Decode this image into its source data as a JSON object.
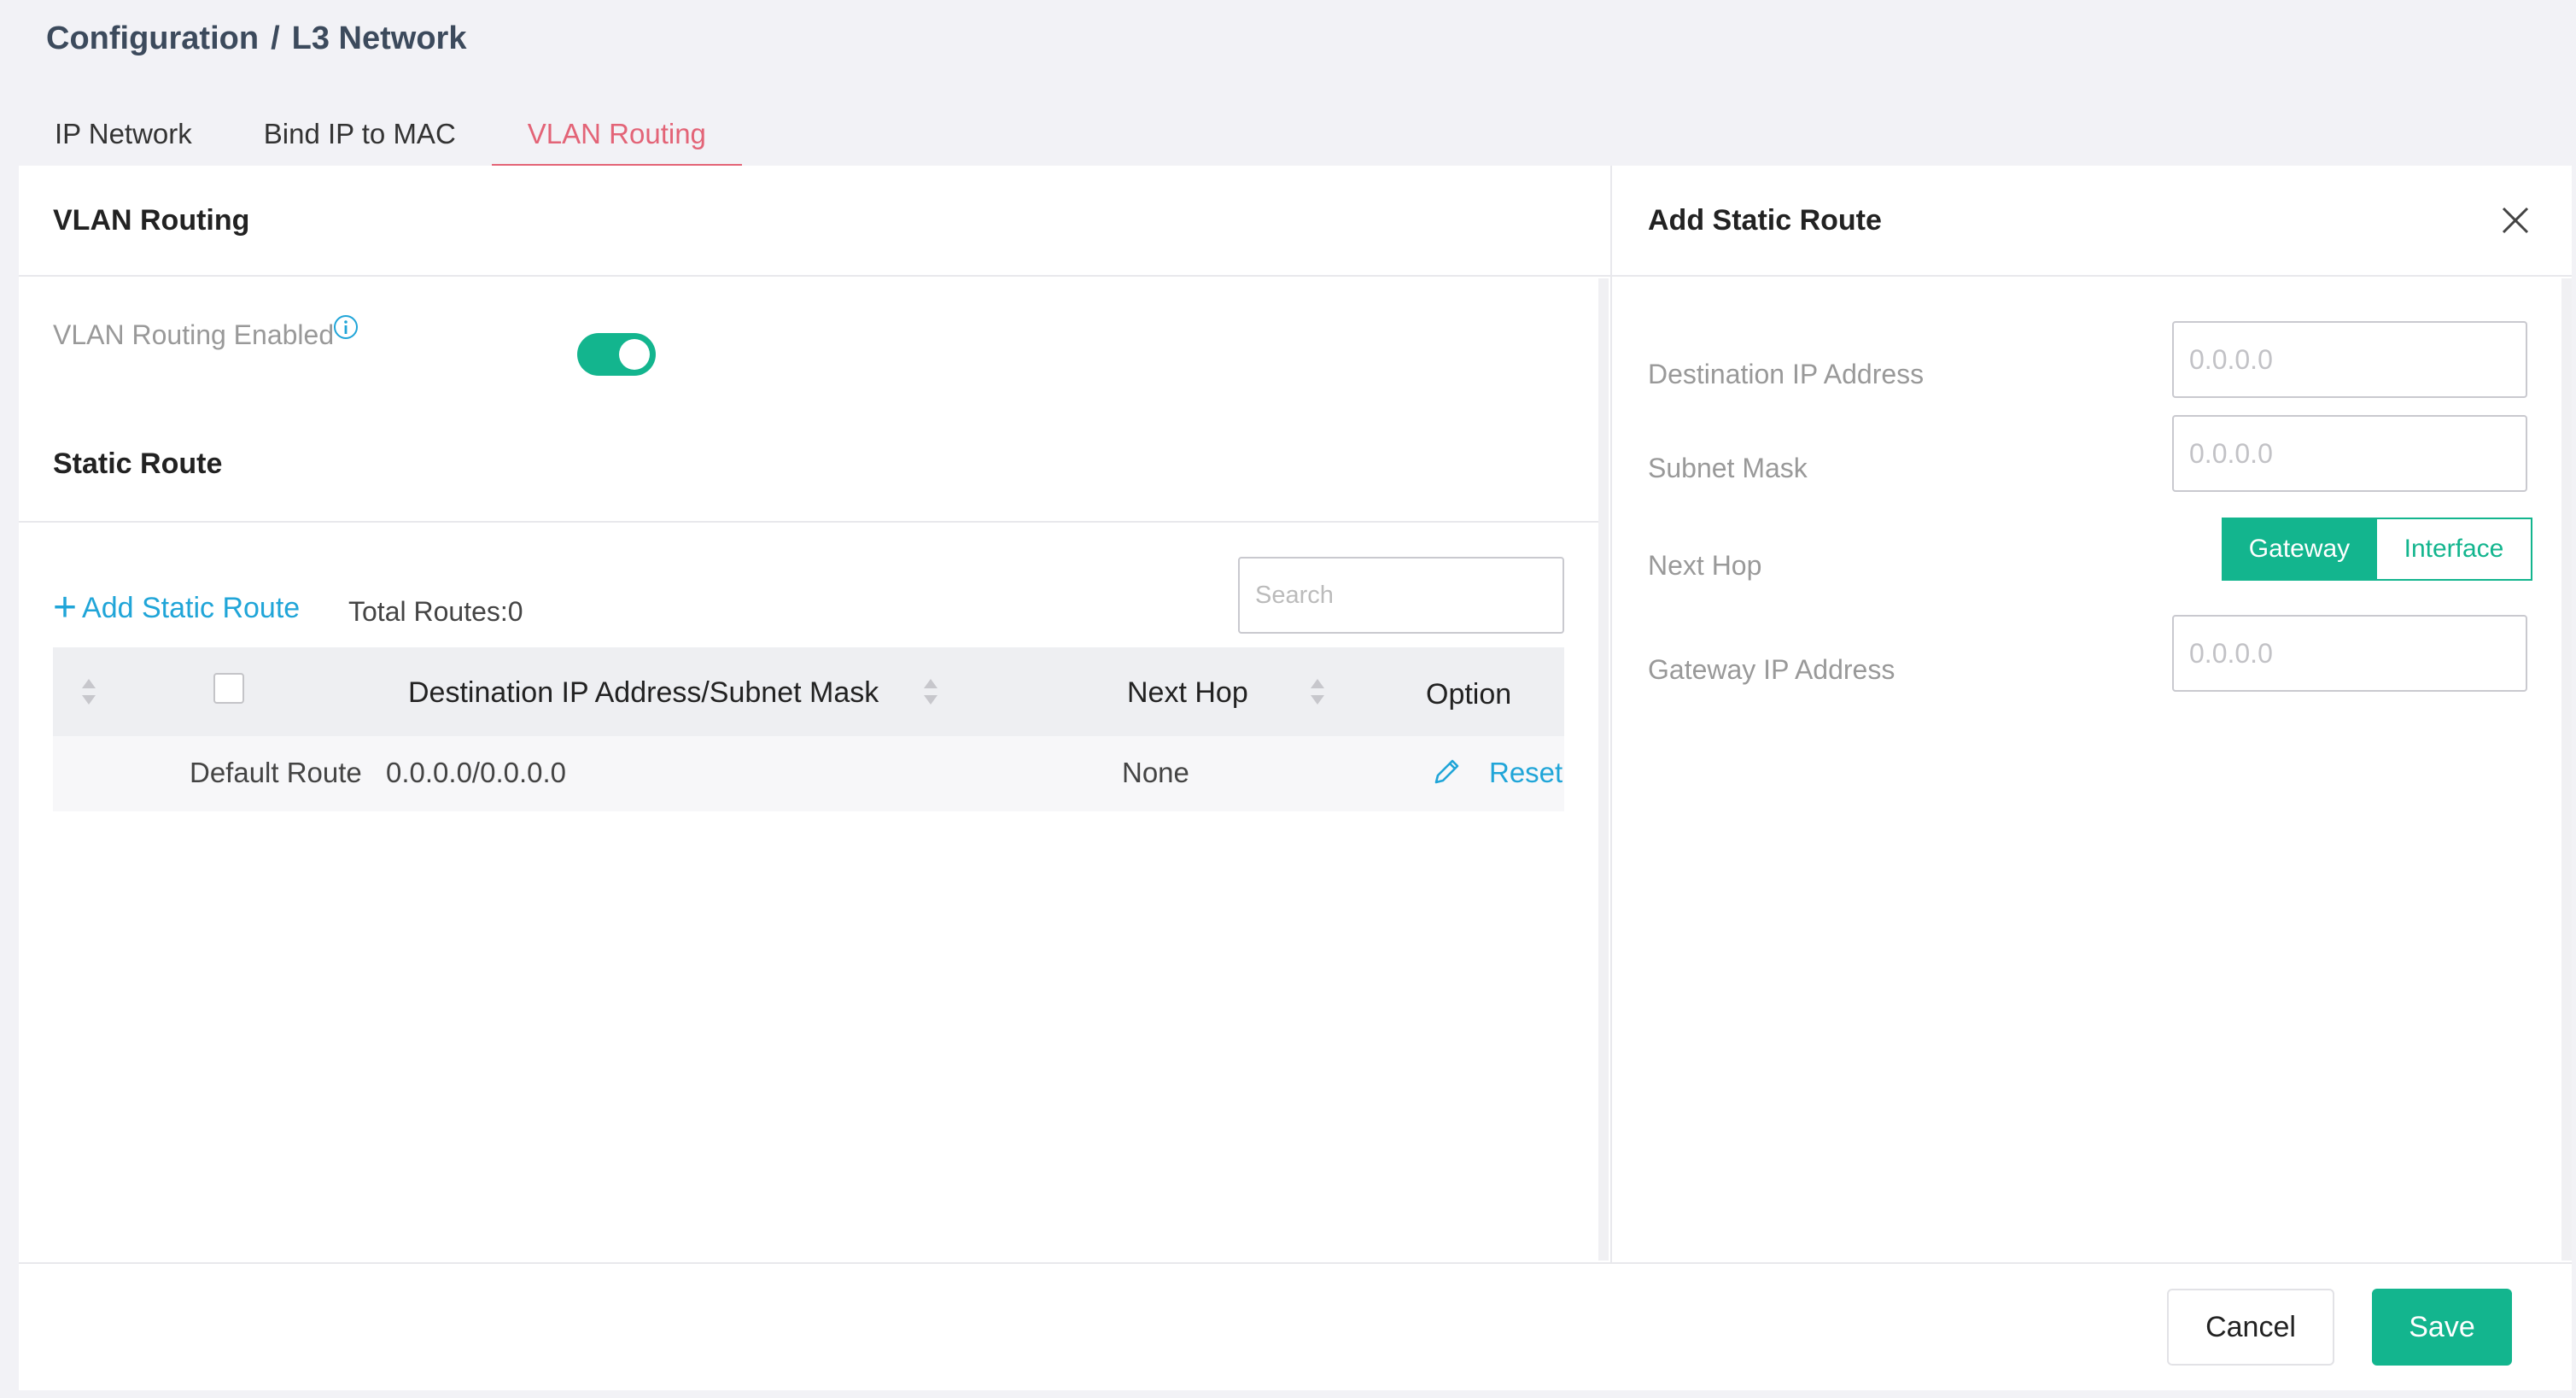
{
  "breadcrumb": {
    "root": "Configuration",
    "separator": "/",
    "current": "L3 Network"
  },
  "tabs": [
    {
      "label": "IP Network"
    },
    {
      "label": "Bind IP to MAC"
    },
    {
      "label": "VLAN Routing"
    }
  ],
  "left_panel": {
    "title": "VLAN Routing",
    "routing_enabled_label": "VLAN Routing Enabled",
    "routing_enabled": true,
    "section_title": "Static Route",
    "add_route_label": "Add Static Route",
    "total_routes_label": "Total Routes:0",
    "search_placeholder": "Search",
    "table": {
      "columns": [
        "Destination IP Address/Subnet Mask",
        "Next Hop",
        "Option"
      ],
      "rows": [
        {
          "name": "Default Route",
          "destination": "0.0.0.0/0.0.0.0",
          "next_hop": "None",
          "action": "Reset"
        }
      ]
    }
  },
  "right_panel": {
    "title": "Add Static Route",
    "fields": {
      "destination_label": "Destination IP Address",
      "destination_placeholder": "0.0.0.0",
      "subnet_label": "Subnet Mask",
      "subnet_placeholder": "0.0.0.0",
      "next_hop_label": "Next Hop",
      "next_hop_options": [
        "Gateway",
        "Interface"
      ],
      "next_hop_selected": "Gateway",
      "gateway_label": "Gateway IP Address",
      "gateway_placeholder": "0.0.0.0"
    }
  },
  "footer": {
    "cancel_label": "Cancel",
    "save_label": "Save"
  },
  "colors": {
    "accent": "#13b58e",
    "link": "#20a5d8",
    "active_tab": "#e36477"
  },
  "icons": [
    "info-icon",
    "plus-icon",
    "sort-icon",
    "edit-icon",
    "close-icon"
  ]
}
